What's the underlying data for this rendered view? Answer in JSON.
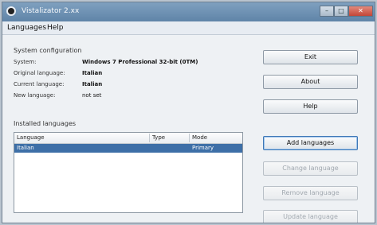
{
  "window": {
    "title": "Vistalizator 2.xx"
  },
  "menu": {
    "items": [
      "Languages",
      "Help"
    ]
  },
  "system": {
    "section_label": "System configuration",
    "rows": [
      {
        "label": "System:",
        "value": "Windows 7 Professional 32-bit (0TM)"
      },
      {
        "label": "Original language:",
        "value": "Italian"
      },
      {
        "label": "Current language:",
        "value": "Italian"
      },
      {
        "label": "New language:",
        "value": "not set"
      }
    ]
  },
  "installed": {
    "section_label": "Installed languages",
    "columns": [
      "Language",
      "Type",
      "Mode"
    ],
    "rows": [
      {
        "language": "Italian",
        "type": "",
        "mode": "Primary"
      }
    ]
  },
  "buttons": {
    "exit": "Exit",
    "about": "About",
    "help": "Help",
    "add_language": "Add languages",
    "change_language": "Change language",
    "remove_language": "Remove language",
    "update_language": "Update language"
  }
}
